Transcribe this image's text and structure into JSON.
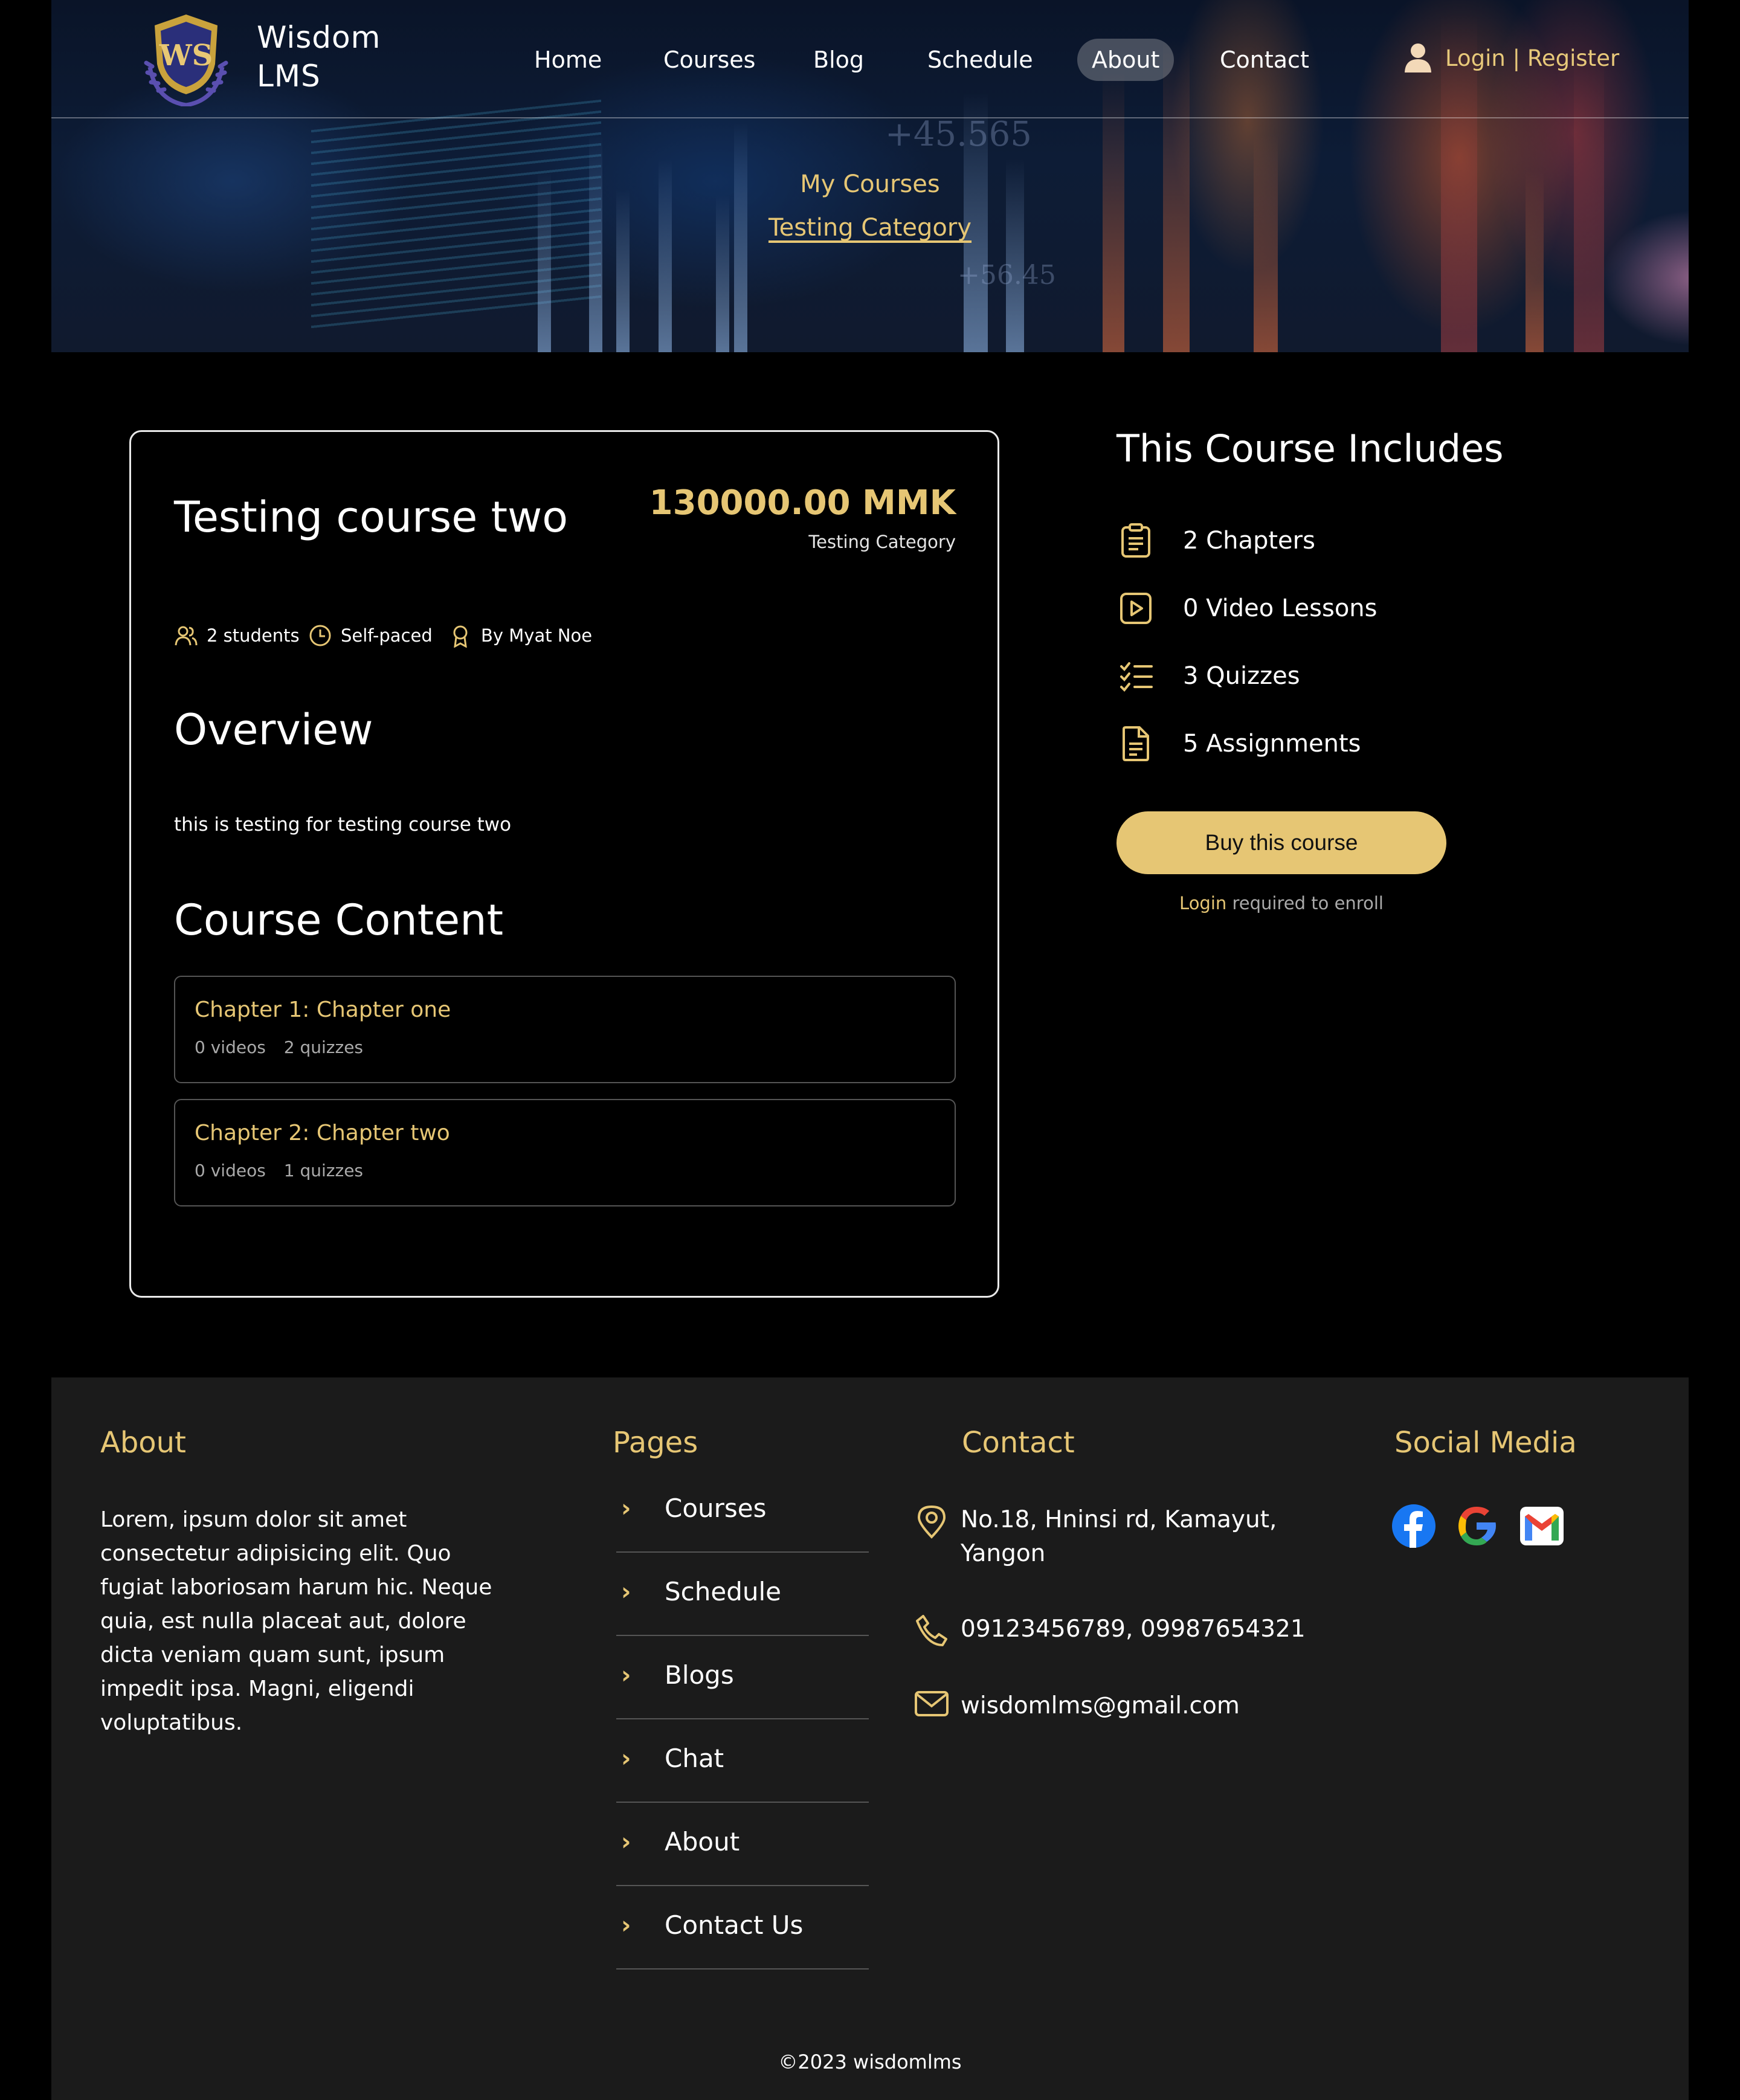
{
  "brand": {
    "line1": "Wisdom",
    "line2": "LMS"
  },
  "nav": {
    "items": [
      "Home",
      "Courses",
      "Blog",
      "Schedule",
      "About",
      "Contact"
    ],
    "active": "About",
    "login": "Login",
    "separator": "|",
    "register": "Register"
  },
  "breadcrumb": {
    "parent": "My Courses",
    "current": "Testing Category"
  },
  "course": {
    "title": "Testing course two",
    "price": "130000.00 MMK",
    "category": "Testing Category",
    "students": "2 students",
    "pace": "Self-paced",
    "instructor": "By Myat Noe",
    "overview_heading": "Overview",
    "overview_text": "this is testing for testing course two",
    "content_heading": "Course Content",
    "chapters": [
      {
        "title": "Chapter 1: Chapter one",
        "videos": "0 videos",
        "quizzes": "2 quizzes"
      },
      {
        "title": "Chapter 2: Chapter two",
        "videos": "0 videos",
        "quizzes": "1 quizzes"
      }
    ]
  },
  "includes": {
    "title": "This Course Includes",
    "items": [
      {
        "icon": "clipboard-list-icon",
        "label": "2 Chapters"
      },
      {
        "icon": "play-square-icon",
        "label": "0 Video Lessons"
      },
      {
        "icon": "checklist-icon",
        "label": "3 Quizzes"
      },
      {
        "icon": "document-icon",
        "label": "5 Assignments"
      }
    ],
    "buy_label": "Buy this course",
    "login_link": "Login",
    "login_suffix": "required to enroll"
  },
  "footer": {
    "about_heading": "About",
    "about_text": "Lorem, ipsum dolor sit amet consectetur adipisicing elit. Quo fugiat laboriosam harum hic. Neque quia, est nulla placeat aut, dolore dicta veniam quam sunt, ipsum impedit ipsa. Magni, eligendi voluptatibus.",
    "pages_heading": "Pages",
    "pages": [
      "Courses",
      "Schedule",
      "Blogs",
      "Chat",
      "About",
      "Contact Us"
    ],
    "contact_heading": "Contact",
    "address_line1": "No.18, Hninsi rd, Kamayut,",
    "address_line2": "Yangon",
    "phone": "09123456789, 09987654321",
    "email": "wisdomlms@gmail.com",
    "social_heading": "Social Media",
    "social": [
      "facebook-icon",
      "google-icon",
      "gmail-icon"
    ],
    "copyright": "©2023 wisdomlms"
  },
  "colors": {
    "accent": "#e6c674",
    "background": "#000000",
    "footer_bg": "#1b1b1b",
    "facebook": "#1877f2"
  }
}
